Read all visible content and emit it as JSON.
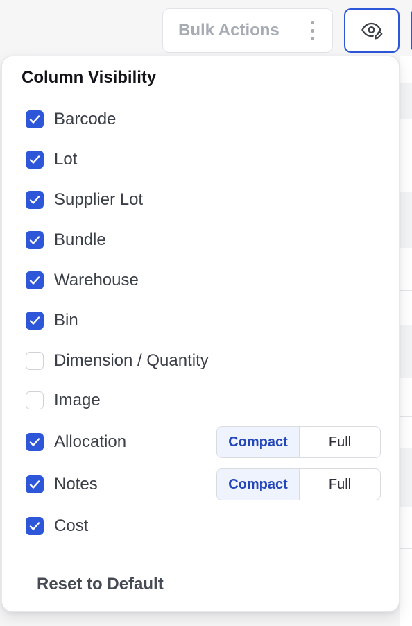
{
  "toolbar": {
    "bulk_actions_label": "Bulk Actions",
    "kebab_icon": "more-vertical-icon",
    "visibility_icon": "eye-edit-icon"
  },
  "panel": {
    "title": "Column Visibility",
    "columns": [
      {
        "label": "Barcode",
        "checked": true
      },
      {
        "label": "Lot",
        "checked": true
      },
      {
        "label": "Supplier Lot",
        "checked": true
      },
      {
        "label": "Bundle",
        "checked": true
      },
      {
        "label": "Warehouse",
        "checked": true
      },
      {
        "label": "Bin",
        "checked": true
      },
      {
        "label": "Dimension / Quantity",
        "checked": false
      },
      {
        "label": "Image",
        "checked": false
      },
      {
        "label": "Allocation",
        "checked": true,
        "mode": {
          "compact": "Compact",
          "full": "Full",
          "selected": "Compact"
        }
      },
      {
        "label": "Notes",
        "checked": true,
        "mode": {
          "compact": "Compact",
          "full": "Full",
          "selected": "Compact"
        }
      },
      {
        "label": "Cost",
        "checked": true
      }
    ],
    "reset_label": "Reset to Default"
  },
  "colors": {
    "accent": "#2d56d8",
    "segment_active_bg": "#eef3fd",
    "segment_active_text": "#2346b8"
  }
}
